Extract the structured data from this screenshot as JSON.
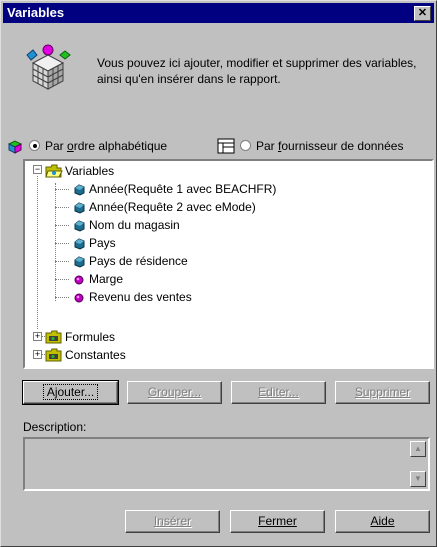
{
  "window": {
    "title": "Variables",
    "close_glyph": "✕"
  },
  "intro": {
    "text": "Vous pouvez ici ajouter, modifier et supprimer des variables, ainsi qu'en insérer dans le rapport.",
    "icon": "variables-cube-icon"
  },
  "sort": {
    "option1_prefix": "Par ",
    "option1_u": "o",
    "option1_rest": "rdre alphabétique",
    "option2_prefix": "Par ",
    "option2_u": "f",
    "option2_rest": "ournisseur de données",
    "selected": "alphabetical"
  },
  "tree": {
    "root_label": "Variables",
    "items": [
      {
        "label": "Année(Requête 1 avec BEACHFR)",
        "kind": "dimension"
      },
      {
        "label": "Année(Requête 2 avec eMode)",
        "kind": "dimension"
      },
      {
        "label": "Nom du magasin",
        "kind": "dimension"
      },
      {
        "label": "Pays",
        "kind": "dimension"
      },
      {
        "label": "Pays de résidence",
        "kind": "dimension"
      },
      {
        "label": "Marge",
        "kind": "measure"
      },
      {
        "label": "Revenu des ventes",
        "kind": "measure"
      }
    ],
    "folders": [
      "Formules",
      "Constantes"
    ]
  },
  "buttons": {
    "ajouter": "Ajouter...",
    "grouper": "Grouper...",
    "editer": "Editer...",
    "supprimer": "Supprimer",
    "inserer": "Insérer",
    "fermer": "Fermer",
    "aide": "Aide"
  },
  "description": {
    "label": "Description:",
    "value": ""
  },
  "colors": {
    "dimension": "#1d6d8f",
    "measure": "#c000c0",
    "title_bar": "#000080"
  }
}
